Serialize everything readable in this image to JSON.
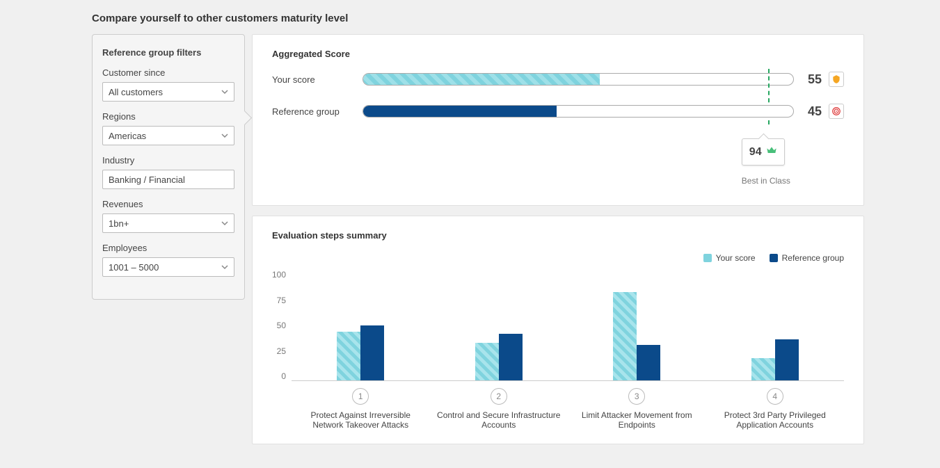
{
  "title": "Compare yourself to other customers maturity level",
  "sidebar": {
    "title": "Reference group filters",
    "filters": [
      {
        "label": "Customer since",
        "value": "All customers"
      },
      {
        "label": "Regions",
        "value": "Americas"
      },
      {
        "label": "Industry",
        "value": "Banking / Financial"
      },
      {
        "label": "Revenues",
        "value": "1bn+"
      },
      {
        "label": "Employees",
        "value": "1001 – 5000"
      }
    ]
  },
  "aggregated": {
    "title": "Aggregated Score",
    "your_label": "Your score",
    "your_value": "55",
    "ref_label": "Reference group",
    "ref_value": "45",
    "best_value": "94",
    "best_label": "Best in Class",
    "best_pct": 94
  },
  "evaluation": {
    "title": "Evaluation steps summary",
    "legend_your": "Your score",
    "legend_ref": "Reference group"
  },
  "yticks": [
    "100",
    "75",
    "50",
    "25",
    "0"
  ],
  "chart_data": {
    "type": "bar",
    "ylim": [
      0,
      100
    ],
    "ylabel": "",
    "categories": [
      "Protect Against Irreversible Network Takeover Attacks",
      "Control and Secure Infrastructure Accounts",
      "Limit Attacker Movement from Endpoints",
      "Protect 3rd Party Privileged Application Accounts"
    ],
    "numbers": [
      "1",
      "2",
      "3",
      "4"
    ],
    "series": [
      {
        "name": "Your score",
        "values": [
          44,
          34,
          80,
          20
        ]
      },
      {
        "name": "Reference group",
        "values": [
          50,
          42,
          32,
          37
        ]
      }
    ]
  }
}
